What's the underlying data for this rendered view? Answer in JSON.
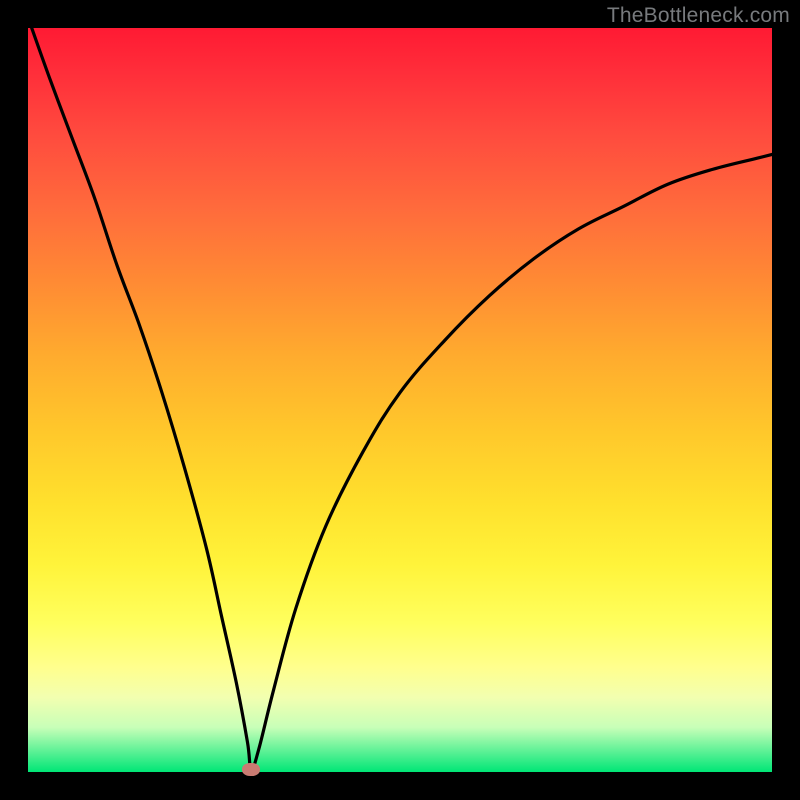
{
  "watermark": "TheBottleneck.com",
  "colors": {
    "curve": "#000000",
    "marker": "#c97b72",
    "frame": "#000000"
  },
  "chart_data": {
    "type": "line",
    "title": "",
    "xlabel": "",
    "ylabel": "",
    "xlim": [
      0,
      1
    ],
    "ylim": [
      0,
      1
    ],
    "marker": {
      "x": 0.3,
      "y": 0.003
    },
    "series": [
      {
        "name": "bottleneck-curve",
        "x": [
          0.005,
          0.03,
          0.06,
          0.09,
          0.12,
          0.15,
          0.18,
          0.21,
          0.24,
          0.26,
          0.28,
          0.295,
          0.3,
          0.31,
          0.33,
          0.36,
          0.4,
          0.45,
          0.5,
          0.56,
          0.62,
          0.68,
          0.74,
          0.8,
          0.86,
          0.92,
          0.98,
          1.0
        ],
        "y": [
          1.0,
          0.93,
          0.85,
          0.77,
          0.68,
          0.6,
          0.51,
          0.41,
          0.3,
          0.21,
          0.12,
          0.04,
          0.003,
          0.03,
          0.11,
          0.22,
          0.33,
          0.43,
          0.51,
          0.58,
          0.64,
          0.69,
          0.73,
          0.76,
          0.79,
          0.81,
          0.825,
          0.83
        ]
      }
    ]
  }
}
